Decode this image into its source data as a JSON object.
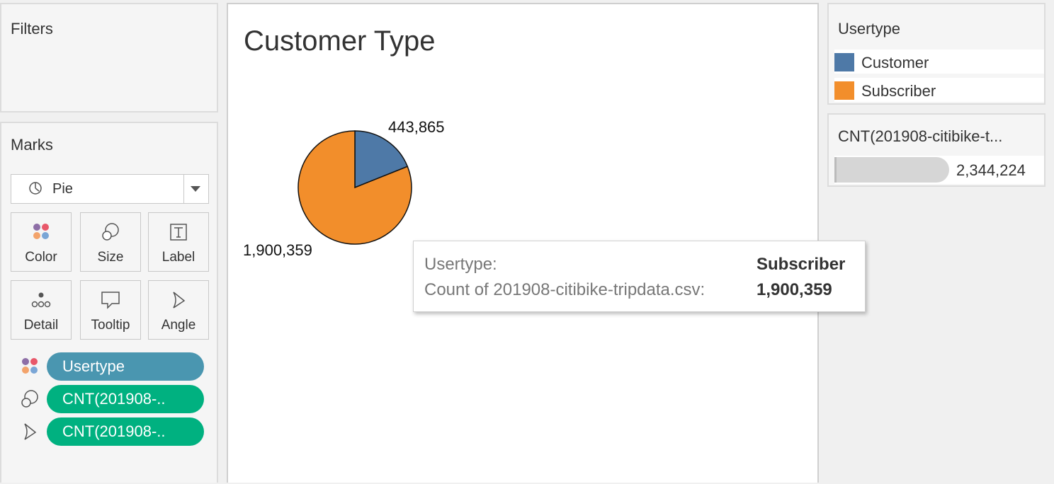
{
  "filters": {
    "title": "Filters"
  },
  "marks": {
    "title": "Marks",
    "mark_type": "Pie",
    "buttons": [
      {
        "label": "Color",
        "icon": "color-dots-icon"
      },
      {
        "label": "Size",
        "icon": "size-circles-icon"
      },
      {
        "label": "Label",
        "icon": "label-t-icon"
      },
      {
        "label": "Detail",
        "icon": "detail-dots-icon"
      },
      {
        "label": "Tooltip",
        "icon": "tooltip-bubble-icon"
      },
      {
        "label": "Angle",
        "icon": "angle-icon"
      }
    ],
    "pills": [
      {
        "label": "Usertype",
        "icon": "color-dots-icon",
        "color": "#4a96b0"
      },
      {
        "label": "CNT(201908-..",
        "icon": "size-circles-icon",
        "color": "#00b180"
      },
      {
        "label": "CNT(201908-..",
        "icon": "angle-icon",
        "color": "#00b180"
      }
    ]
  },
  "viz": {
    "title": "Customer Type",
    "tooltip": {
      "key1": "Usertype:",
      "val1": "Subscriber",
      "key2": "Count of 201908-citibike-tripdata.csv:",
      "val2": "1,900,359"
    }
  },
  "chart_data": {
    "type": "pie",
    "title": "Customer Type",
    "categories": [
      "Customer",
      "Subscriber"
    ],
    "values": [
      443865,
      1900359
    ],
    "labels": [
      "443,865",
      "1,900,359"
    ],
    "colors": [
      "#4e79a7",
      "#f28e2b"
    ]
  },
  "legend": {
    "title": "Usertype",
    "items": [
      {
        "label": "Customer",
        "color": "#4e79a7"
      },
      {
        "label": "Subscriber",
        "color": "#f28e2b"
      }
    ]
  },
  "size_legend": {
    "title": "CNT(201908-citibike-t...",
    "value": "2,344,224"
  }
}
